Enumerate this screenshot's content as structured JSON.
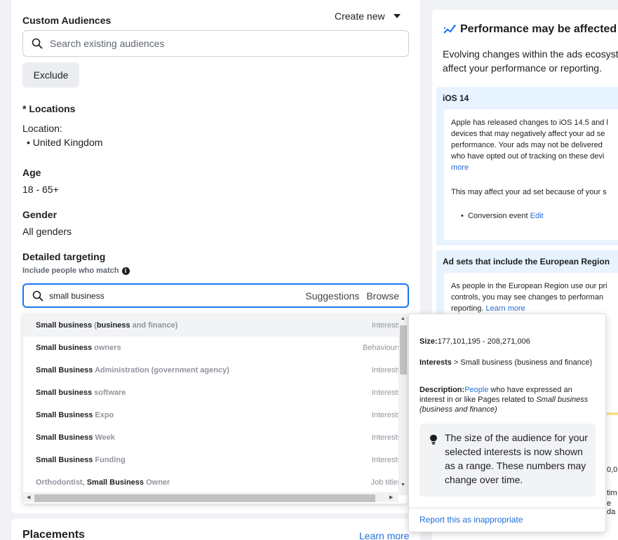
{
  "custom_audiences": {
    "title": "Custom Audiences",
    "create_new": "Create new",
    "search_placeholder": "Search existing audiences",
    "exclude_label": "Exclude"
  },
  "locations": {
    "title": "* Locations",
    "label": "Location:",
    "item": "United Kingdom"
  },
  "age": {
    "title": "Age",
    "value": "18 - 65+"
  },
  "gender": {
    "title": "Gender",
    "value": "All genders"
  },
  "detailed_targeting": {
    "title": "Detailed targeting",
    "subtitle": "Include people who match",
    "search_value": "small business",
    "suggestions": "Suggestions",
    "browse": "Browse"
  },
  "dropdown": {
    "rows": [
      {
        "parts": [
          [
            "Small business ",
            "b"
          ],
          [
            "(",
            "d"
          ],
          [
            "business",
            "b"
          ],
          [
            " and finance)",
            "g"
          ]
        ],
        "type": "Interests"
      },
      {
        "parts": [
          [
            "Small business ",
            "b"
          ],
          [
            "owners",
            "g"
          ]
        ],
        "type": "Behaviours"
      },
      {
        "parts": [
          [
            "Small Business ",
            "b"
          ],
          [
            "Administration (government agency)",
            "g"
          ]
        ],
        "type": "Interests"
      },
      {
        "parts": [
          [
            "Small business ",
            "b"
          ],
          [
            "software",
            "g"
          ]
        ],
        "type": "Interests"
      },
      {
        "parts": [
          [
            "Small Business ",
            "b"
          ],
          [
            "Expo",
            "g"
          ]
        ],
        "type": "Interests"
      },
      {
        "parts": [
          [
            "Small Business ",
            "b"
          ],
          [
            "Week",
            "g"
          ]
        ],
        "type": "Interests"
      },
      {
        "parts": [
          [
            "Small Business ",
            "b"
          ],
          [
            "Funding",
            "g"
          ]
        ],
        "type": "Interests"
      },
      {
        "parts": [
          [
            "Orthodontist, ",
            "g"
          ],
          [
            "Small Business",
            "b"
          ],
          [
            " Owner",
            "g"
          ]
        ],
        "type": "Job titles"
      }
    ]
  },
  "tooltip": {
    "size_label": "Size:",
    "size_value": "177,101,195 - 208,271,006",
    "category_a": "Interests",
    "category_b": " > Small business (business and finance)",
    "desc_label": "Description:",
    "desc_link": "People",
    "desc_text": " who have expressed an interest in or like Pages related to ",
    "desc_italic": "Small business (business and finance)",
    "tip": "The size of the audience for your selected interests is now shown as a range. These numbers may change over time.",
    "report": "Report this as inappropriate"
  },
  "placements": {
    "title": "Placements",
    "learn_more": "Learn more"
  },
  "right_panel": {
    "title": "Performance may be affected",
    "body_line1": "Evolving changes within the ads ecosyst",
    "body_line2": "affect your performance or reporting.",
    "ios_title": "iOS 14",
    "ios_lines": [
      "Apple has released changes to iOS 14.5 and l",
      "devices that may negatively affect your ad se",
      "performance. Your ads may not be delivered",
      "who have opted out of tracking on these devi"
    ],
    "ios_more": "more",
    "ios_affect": "This may affect your ad set because of your s",
    "conversion_label": "Conversion event ",
    "conversion_edit": "Edit",
    "eu_title": "Ad sets that include the European Region",
    "eu_lines": [
      "As people in the European Region use our pri",
      "controls, you may see changes to performan"
    ],
    "eu_reporting": "reporting. ",
    "eu_learn_more": "Learn more",
    "frag_a": "0,0",
    "frag_b": "tim",
    "frag_c": "e da"
  },
  "colors": {
    "accent": "#1877f2",
    "link": "#216fdb"
  }
}
